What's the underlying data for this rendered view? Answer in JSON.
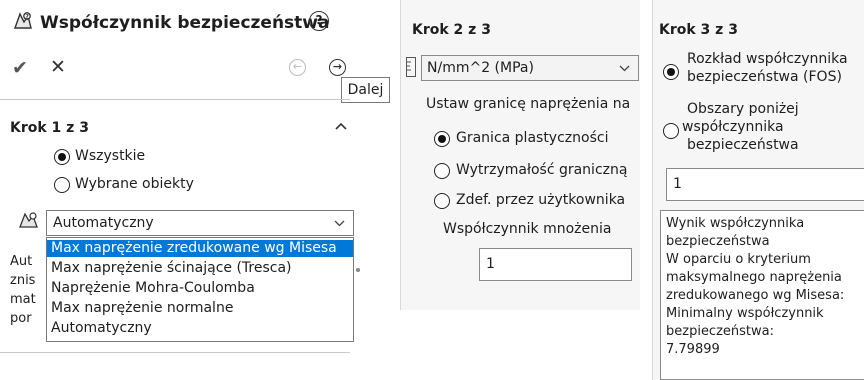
{
  "panel1": {
    "title": "Współczynnik bezpieczeństwa",
    "help": "?",
    "tooltip": "Dalej",
    "step": "Krok 1 z 3",
    "radio_all": "Wszystkie",
    "radio_selected": "Wybrane obiekty",
    "criterion_value": "Automatyczny",
    "dropdown_options": [
      "Max naprężenie zredukowane wg Misesa",
      "Max naprężenie ścinające (Tresca)",
      "Naprężenie Mohra-Coulomba",
      "Max naprężenie normalne",
      "Automatyczny"
    ],
    "occluded_text": [
      "Aut",
      "znis",
      "mat",
      "por"
    ]
  },
  "panel2": {
    "step": "Krok 2 z 3",
    "unit": "N/mm^2 (MPa)",
    "limit_label": "Ustaw granicę naprężenia na",
    "radio_yield": "Granica plastyczności",
    "radio_ultimate": "Wytrzymałość graniczną",
    "radio_user": "Zdef. przez użytkownika",
    "multiplier_label": "Współczynnik mnożenia",
    "multiplier_value": "1"
  },
  "panel3": {
    "step": "Krok 3 z 3",
    "radio_fos_lines": [
      "Rozkład współczynnika",
      "bezpieczeństwa (FOS)"
    ],
    "radio_areas_lines": [
      "Obszary poniżej",
      "współczynnika",
      "bezpieczeństwa"
    ],
    "value": "1",
    "result_lines": [
      "Wynik współczynnika",
      "bezpieczeństwa",
      "W oparciu o kryterium",
      "maksymalnego naprężenia",
      "zredukowanego wg Misesa:",
      "Minimalny współczynnik",
      "bezpieczeństwa:",
      "7.79899"
    ]
  },
  "colors": {
    "selection": "#0078d7",
    "panel_bg": "#f6f6f6"
  },
  "icons": [
    "factor-of-safety-icon",
    "help-icon",
    "check-icon",
    "close-icon",
    "back-arrow-icon",
    "next-arrow-icon",
    "criterion-icon",
    "units-icon",
    "collapse-chevron-icon",
    "dropdown-chevron-icon"
  ]
}
